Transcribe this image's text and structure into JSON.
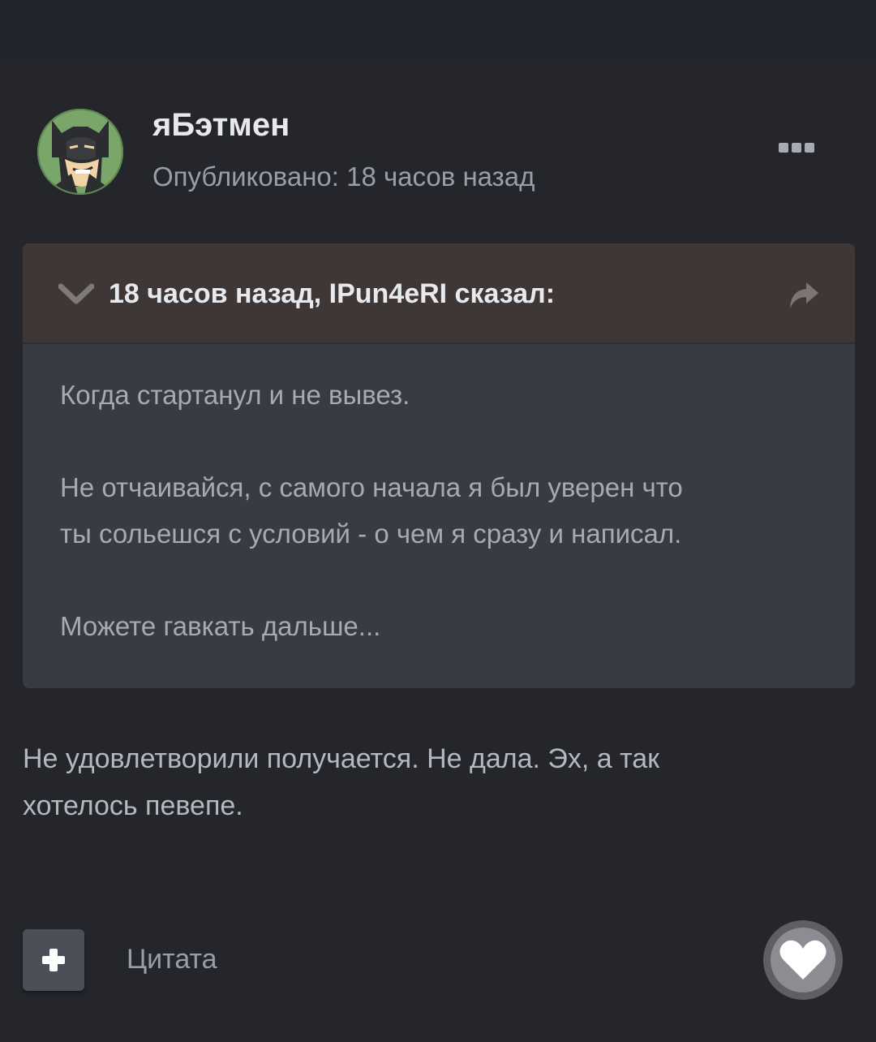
{
  "author": {
    "name": "яБэтмен",
    "avatar_icon": "batman-avatar"
  },
  "post": {
    "meta": "Опубликовано: 18 часов назад"
  },
  "quote": {
    "attribution": "18 часов назад, IPun4eRI сказал:",
    "paragraphs": [
      [
        "Когда стартанул и не вывез."
      ],
      [
        "Не отчаивайся, с самого начала я был уверен что",
        "ты сольешся с условий - о чем я сразу и написал."
      ],
      [
        "Можете гавкать дальше..."
      ]
    ]
  },
  "reply": {
    "lines": [
      "Не удовлетворили получается. Не дала. Эх, а так",
      "хотелось певепе."
    ]
  },
  "footer": {
    "quote_label": "Цитата",
    "add_icon": "plus-icon",
    "like_icon": "heart-icon"
  },
  "colors": {
    "page_bg": "#24262c",
    "quote_header_bg": "#3f3735",
    "quote_body_bg": "#373c42",
    "name_text": "#e7e9ee",
    "muted_text": "#9a9ea6"
  }
}
